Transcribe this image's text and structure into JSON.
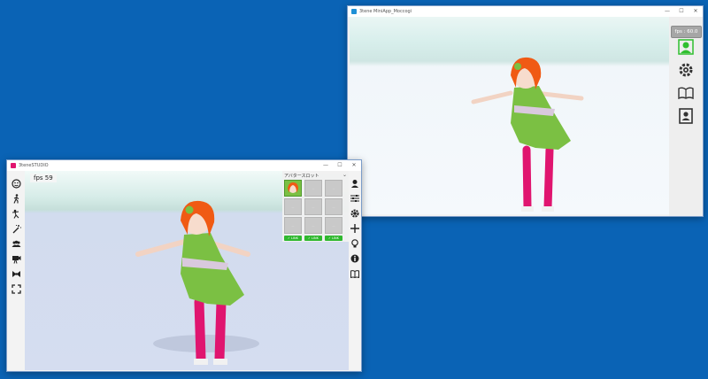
{
  "viewer_window": {
    "title": "3tene MiniApp_Moccogi",
    "controls": {
      "minimize": "—",
      "maximize": "☐",
      "close": "✕"
    },
    "fps": "fps : 60.0",
    "side_icons": [
      "face-tracking-icon",
      "gear-icon",
      "book-icon",
      "profile-icon"
    ]
  },
  "studio_window": {
    "title": "3teneSTUDIO",
    "controls": {
      "minimize": "—",
      "maximize": "☐",
      "close": "✕"
    },
    "fps": "fps 59",
    "avatar_slot_title": "アバタースロット",
    "slot_placeholder": "—",
    "link_label": "✓ LINK",
    "left_tools": [
      "face-icon",
      "walk-icon",
      "pose-icon",
      "wand-icon",
      "group-icon",
      "camera-icon",
      "bow-icon",
      "fullscreen-icon"
    ],
    "right_tools": [
      "avatar-bust-icon",
      "sliders-icon",
      "gear-icon",
      "move-icon",
      "lightbulb-icon",
      "info-icon",
      "book-icon"
    ]
  },
  "colors": {
    "desktop": "#0a63b5",
    "accent_green": "#2fb82f",
    "avatar_hair": "#f05a14",
    "avatar_dress": "#7bc043",
    "avatar_socks": "#e0156f"
  }
}
